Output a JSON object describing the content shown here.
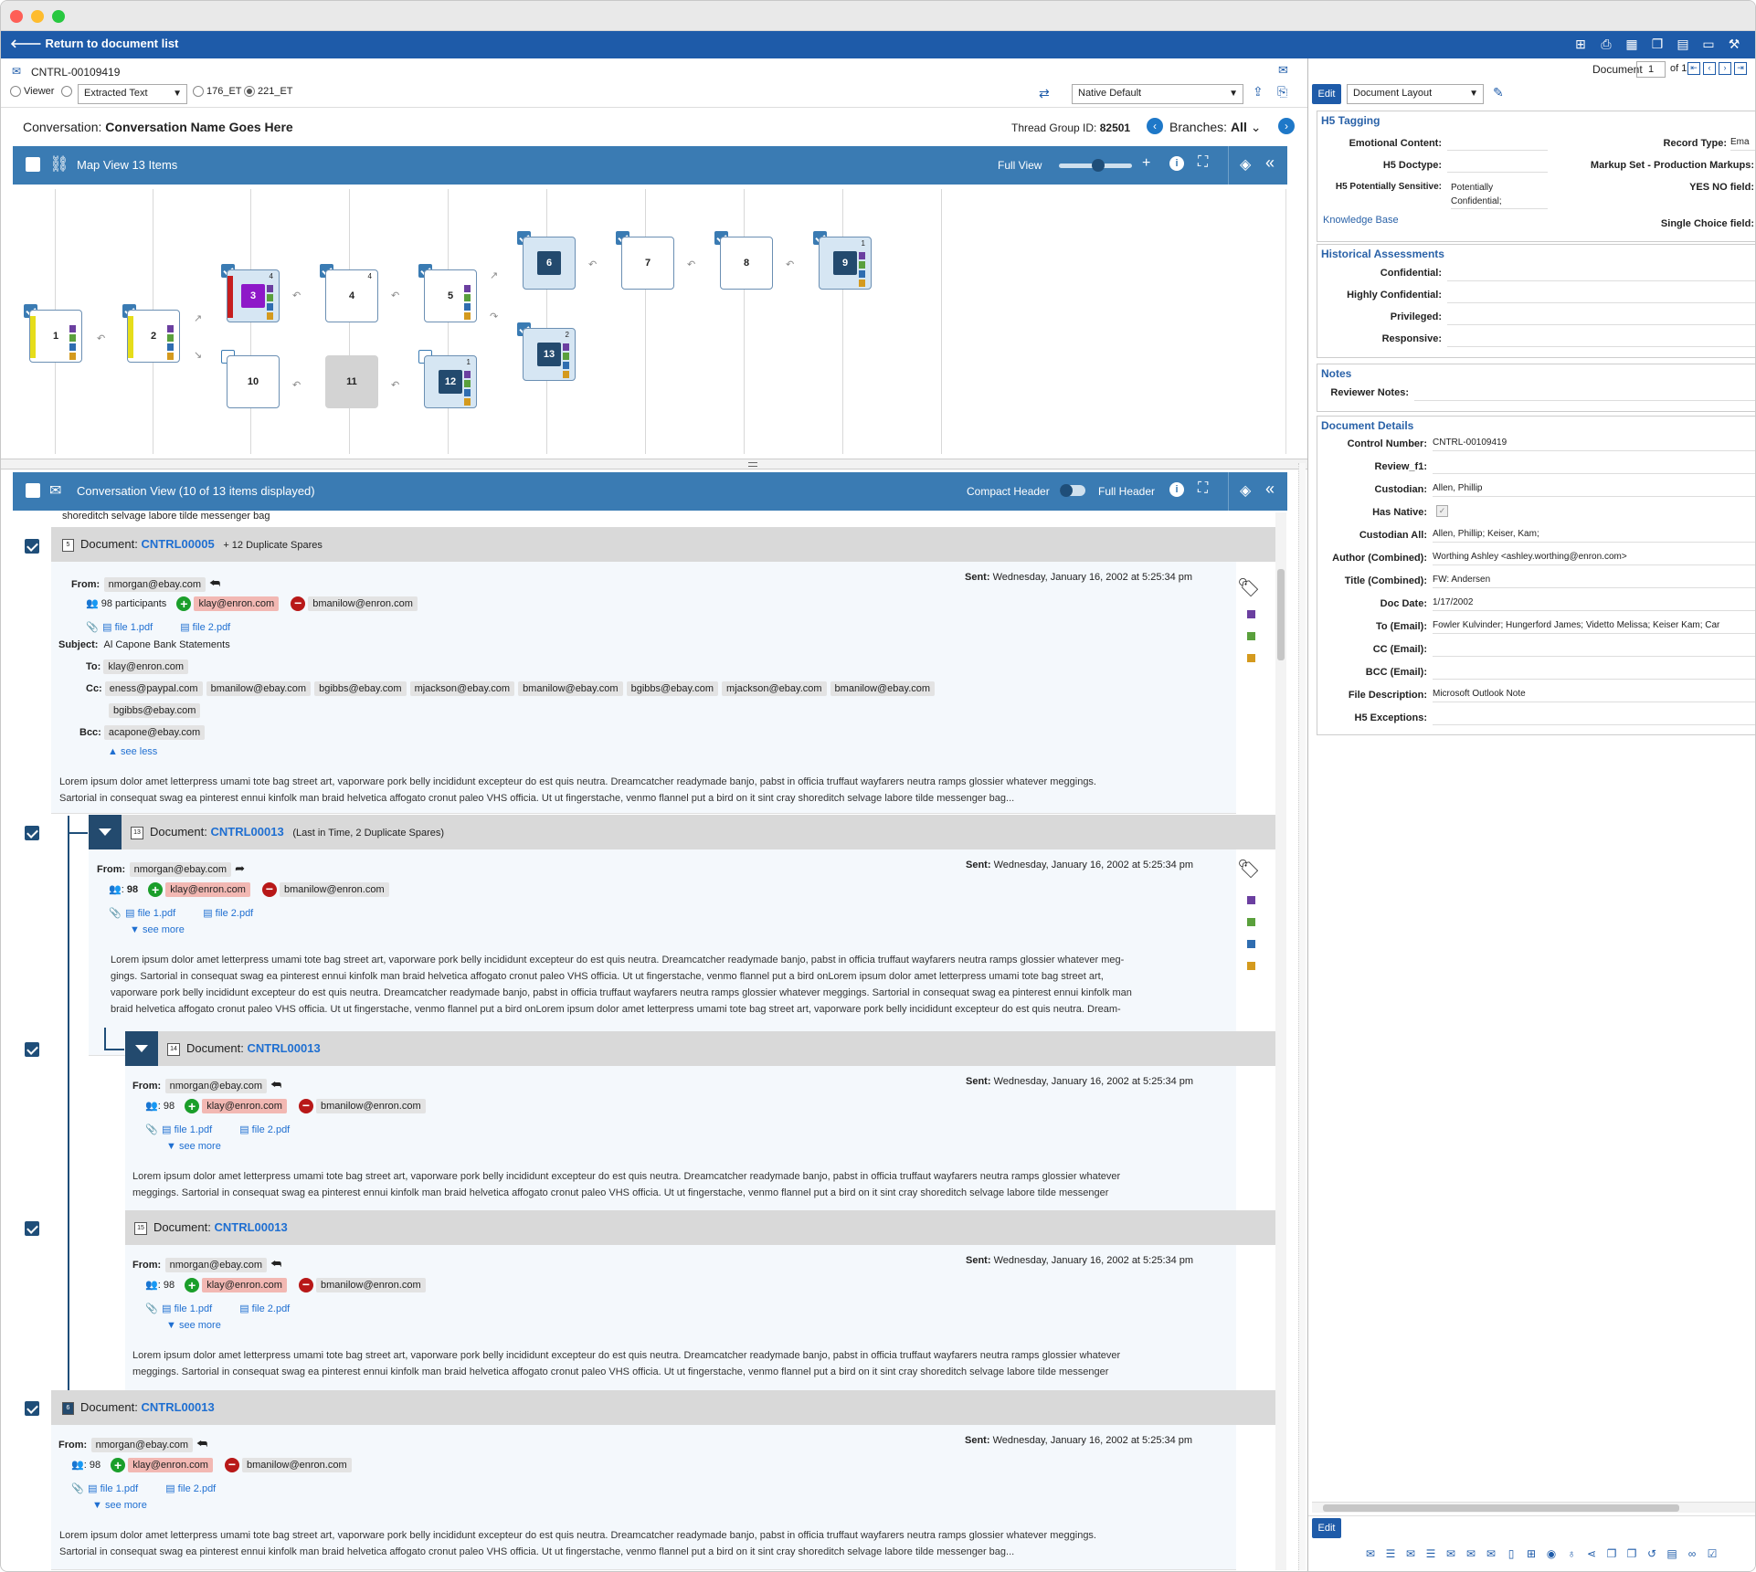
{
  "window": {
    "colors": {
      "red": "#fe5f57",
      "yellow": "#febc2e",
      "green": "#28c840",
      "nav": "#1e5ba9",
      "bar": "#3a7bb3"
    }
  },
  "topnav": {
    "back_label": "Return to document list",
    "icons": [
      "add-icon",
      "print-icon",
      "grid-icon",
      "window-icon",
      "layout-icon",
      "monitor-icon",
      "tools-icon"
    ]
  },
  "docbar": {
    "control": "CNTRL-00109419",
    "viewer_label": "Viewer",
    "extracted_text": "Extracted Text",
    "opt1": "176_ET",
    "opt2": "221_ET",
    "native_default": "Native Default",
    "document_label": "Document",
    "doc_num": "1",
    "of_label": "of 1"
  },
  "conversation": {
    "label": "Conversation:",
    "name": "Conversation Name Goes Here",
    "thread_label": "Thread Group ID:",
    "thread_id": "82501",
    "branches_label": "Branches:",
    "branches_value": "All"
  },
  "mapview": {
    "title": "Map View 13 Items",
    "full_view": "Full View",
    "nodes": [
      {
        "id": "1",
        "check": true,
        "count": ""
      },
      {
        "id": "2",
        "check": true,
        "count": ""
      },
      {
        "id": "3",
        "check": true,
        "count": "4"
      },
      {
        "id": "4",
        "check": true,
        "count": "4"
      },
      {
        "id": "5",
        "check": true,
        "count": ""
      },
      {
        "id": "6",
        "check": true,
        "count": ""
      },
      {
        "id": "7",
        "check": true,
        "count": ""
      },
      {
        "id": "8",
        "check": true,
        "count": ""
      },
      {
        "id": "9",
        "check": true,
        "count": "1"
      },
      {
        "id": "10",
        "check": false,
        "count": ""
      },
      {
        "id": "11",
        "check": false,
        "count": ""
      },
      {
        "id": "12",
        "check": false,
        "count": "1"
      },
      {
        "id": "13",
        "check": true,
        "count": "2"
      }
    ]
  },
  "convview": {
    "title": "Conversation View (10 of 13 items displayed)",
    "compact": "Compact Header",
    "full": "Full Header",
    "top_snippet": "shoreditch selvage labore tilde messenger bag",
    "doc1": {
      "doc_label": "Document:",
      "doc_id": "CNTRL00005",
      "extra": "+ 12 Duplicate Spares",
      "icon": "5",
      "from_label": "From:",
      "from": "nmorgan@ebay.com",
      "participants": "98 participants",
      "added": "klay@enron.com",
      "removed": "bmanilow@enron.com",
      "file1": "file 1.pdf",
      "file2": "file 2.pdf",
      "sent_label": "Sent:",
      "sent": "Wednesday, January 16, 2002 at 5:25:34 pm",
      "subject_label": "Subject:",
      "subject": "Al Capone Bank Statements",
      "to_label": "To:",
      "to": "klay@enron.com",
      "cc_label": "Cc:",
      "cc": [
        "eness@paypal.com",
        "bmanilow@ebay.com",
        "bgibbs@ebay.com",
        "mjackson@ebay.com",
        "bmanilow@ebay.com",
        "bgibbs@ebay.com",
        "mjackson@ebay.com",
        "bmanilow@ebay.com",
        "bgibbs@ebay.com"
      ],
      "bcc_label": "Bcc:",
      "bcc": "acapone@ebay.com",
      "see_less": "see less",
      "body1": "Lorem ipsum dolor amet letterpress umami tote bag street art, vaporware pork belly incididunt excepteur do est quis neutra. Dreamcatcher readymade banjo, pabst in officia truffaut wayfarers neutra ramps glossier whatever meggings.",
      "body2": "Sartorial in consequat swag ea pinterest ennui kinfolk man braid helvetica affogato cronut paleo VHS officia. Ut ut fingerstache, venmo flannel put a bird on it sint cray shoreditch selvage labore tilde messenger bag..."
    },
    "doc2": {
      "doc_label": "Document:",
      "doc_id": "CNTRL00013",
      "extra": "(Last in Time, 2 Duplicate Spares)",
      "icon": "13",
      "from_label": "From:",
      "from": "nmorgan@ebay.com",
      "participants": "98",
      "added": "klay@enron.com",
      "removed": "bmanilow@enron.com",
      "file1": "file 1.pdf",
      "file2": "file 2.pdf",
      "sent_label": "Sent:",
      "sent": "Wednesday, January 16, 2002 at 5:25:34 pm",
      "see_more": "see more",
      "body1": "Lorem ipsum dolor amet letterpress umami tote bag street art, vaporware pork belly incididunt excepteur do est quis neutra. Dreamcatcher readymade banjo, pabst in officia truffaut wayfarers neutra ramps glossier whatever meg-",
      "body2": "gings. Sartorial in consequat swag ea pinterest ennui kinfolk man braid helvetica affogato cronut paleo VHS officia. Ut ut fingerstache, venmo flannel put a bird onLorem ipsum dolor amet letterpress umami tote bag street art,",
      "body3": "vaporware pork belly incididunt excepteur do est quis neutra. Dreamcatcher readymade banjo, pabst in officia truffaut wayfarers neutra ramps glossier whatever meggings. Sartorial in consequat swag ea pinterest ennui kinfolk man",
      "body4": "braid helvetica affogato cronut paleo VHS officia. Ut ut fingerstache, venmo flannel put a bird onLorem ipsum dolor amet letterpress umami tote bag street art, vaporware pork belly incididunt excepteur do est quis neutra. Dream-"
    },
    "doc3": {
      "doc_label": "Document:",
      "doc_id": "CNTRL00013",
      "icon": "14",
      "from_label": "From:",
      "from": "nmorgan@ebay.com",
      "participants": "98",
      "added": "klay@enron.com",
      "removed": "bmanilow@enron.com",
      "file1": "file 1.pdf",
      "file2": "file 2.pdf",
      "sent_label": "Sent:",
      "sent": "Wednesday, January 16, 2002 at 5:25:34 pm",
      "see_more": "see more",
      "body1": "Lorem ipsum dolor amet letterpress umami tote bag street art, vaporware pork belly incididunt excepteur do est quis neutra. Dreamcatcher readymade banjo, pabst in officia truffaut wayfarers neutra ramps glossier whatever",
      "body2": "meggings. Sartorial in consequat swag ea pinterest ennui kinfolk man braid helvetica affogato cronut paleo VHS officia. Ut ut fingerstache, venmo flannel put a bird on it sint cray shoreditch selvage labore tilde messenger"
    },
    "doc4": {
      "doc_label": "Document:",
      "doc_id": "CNTRL00013",
      "icon": "15",
      "from_label": "From:",
      "from": "nmorgan@ebay.com",
      "participants": "98",
      "added": "klay@enron.com",
      "removed": "bmanilow@enron.com",
      "file1": "file 1.pdf",
      "file2": "file 2.pdf",
      "sent_label": "Sent:",
      "sent": "Wednesday, January 16, 2002 at 5:25:34 pm",
      "see_more": "see more",
      "body1": "Lorem ipsum dolor amet letterpress umami tote bag street art, vaporware pork belly incididunt excepteur do est quis neutra. Dreamcatcher readymade banjo, pabst in officia truffaut wayfarers neutra ramps glossier whatever",
      "body2": "meggings. Sartorial in consequat swag ea pinterest ennui kinfolk man braid helvetica affogato cronut paleo VHS officia. Ut ut fingerstache, venmo flannel put a bird on it sint cray shoreditch selvage labore tilde messenger"
    },
    "doc5": {
      "doc_label": "Document:",
      "doc_id": "CNTRL00013",
      "icon": "6",
      "from_label": "From:",
      "from": "nmorgan@ebay.com",
      "participants": "98",
      "added": "klay@enron.com",
      "removed": "bmanilow@enron.com",
      "file1": "file 1.pdf",
      "file2": "file 2.pdf",
      "sent_label": "Sent:",
      "sent": "Wednesday, January 16, 2002 at 5:25:34 pm",
      "see_more": "see more",
      "body1": "Lorem ipsum dolor amet letterpress umami tote bag street art, vaporware pork belly incididunt excepteur do est quis neutra. Dreamcatcher readymade banjo, pabst in officia truffaut wayfarers neutra ramps glossier whatever meggings.",
      "body2": "Sartorial in consequat swag ea pinterest ennui kinfolk man braid helvetica affogato cronut paleo VHS officia. Ut ut fingerstache, venmo flannel put a bird on it sint cray shoreditch selvage labore tilde messenger bag..."
    }
  },
  "rightpanel": {
    "edit": "Edit",
    "layout": "Document Layout",
    "h5": {
      "title": "H5 Tagging",
      "emotional": "Emotional Content:",
      "record_type": "Record Type:",
      "record_type_value": "Ema",
      "doctype": "H5 Doctype:",
      "markup": "Markup Set - Production Markups:",
      "sensitive": "H5 Potentially Sensitive:",
      "sensitive_v1": "Potentially",
      "sensitive_v2": "Confidential;",
      "yesno": "YES NO field:",
      "kb": "Knowledge Base",
      "single": "Single Choice field:"
    },
    "hist": {
      "title": "Historical Assessments",
      "confidential": "Confidential:",
      "highly": "Highly Confidential:",
      "privileged": "Privileged:",
      "responsive": "Responsive:"
    },
    "notes": {
      "title": "Notes",
      "reviewer": "Reviewer Notes:"
    },
    "details": {
      "title": "Document Details",
      "rows": [
        {
          "label": "Control Number:",
          "value": "CNTRL-00109419"
        },
        {
          "label": "Review_f1:",
          "value": ""
        },
        {
          "label": "Custodian:",
          "value": "Allen, Phillip"
        },
        {
          "label": "Has Native:",
          "value": ""
        },
        {
          "label": "Custodian All:",
          "value": "Allen, Phillip; Keiser, Kam;"
        },
        {
          "label": "Author (Combined):",
          "value": "Worthing  Ashley <ashley.worthing@enron.com>"
        },
        {
          "label": "Title (Combined):",
          "value": "FW: Andersen"
        },
        {
          "label": "Doc Date:",
          "value": "1/17/2002"
        },
        {
          "label": "To (Email):",
          "value": "Fowler  Kulvinder; Hungerford  James; Videtto  Melissa; Keiser  Kam; Car"
        },
        {
          "label": "CC (Email):",
          "value": ""
        },
        {
          "label": "BCC (Email):",
          "value": ""
        },
        {
          "label": "File Description:",
          "value": "Microsoft Outlook Note"
        },
        {
          "label": "H5 Exceptions:",
          "value": ""
        }
      ]
    },
    "edit_bottom": "Edit"
  }
}
